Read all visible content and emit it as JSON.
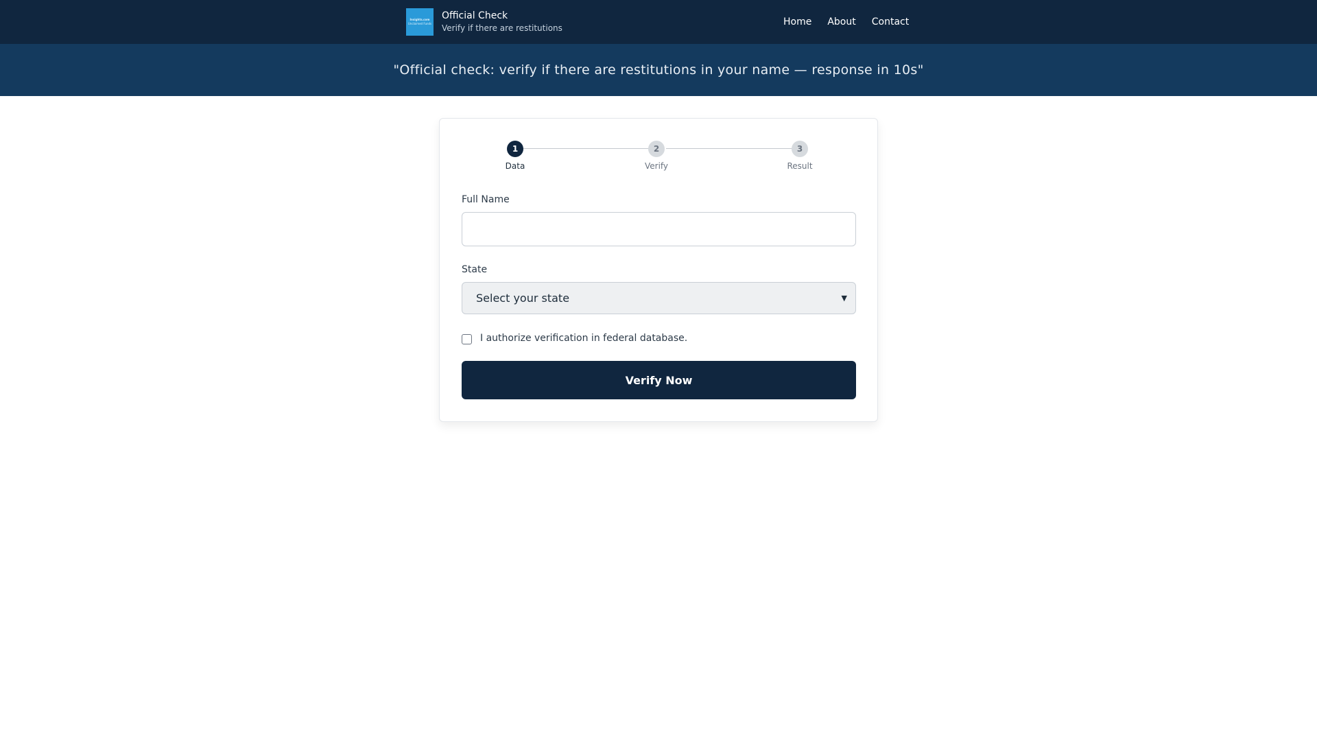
{
  "header": {
    "logo": {
      "line1": "Insights.com",
      "line2": "Unclaimed Funds"
    },
    "title": "Official Check",
    "subtitle": "Verify if there are restitutions",
    "nav": [
      "Home",
      "About",
      "Contact"
    ]
  },
  "banner": {
    "text": "\"Official check: verify if there are restitutions in your name — response in 10s\""
  },
  "steps": [
    {
      "number": "1",
      "label": "Data",
      "active": true
    },
    {
      "number": "2",
      "label": "Verify",
      "active": false
    },
    {
      "number": "3",
      "label": "Result",
      "active": false
    }
  ],
  "form": {
    "full_name_label": "Full Name",
    "full_name_value": "",
    "state_label": "State",
    "state_selected": "Select your state",
    "consent_label": "I authorize verification in federal database.",
    "consent_checked": false,
    "submit_label": "Verify Now"
  },
  "colors": {
    "header_bg": "#10263f",
    "banner_bg": "#143a5e",
    "primary": "#10263f",
    "logo_bg": "#2a9ad9"
  }
}
